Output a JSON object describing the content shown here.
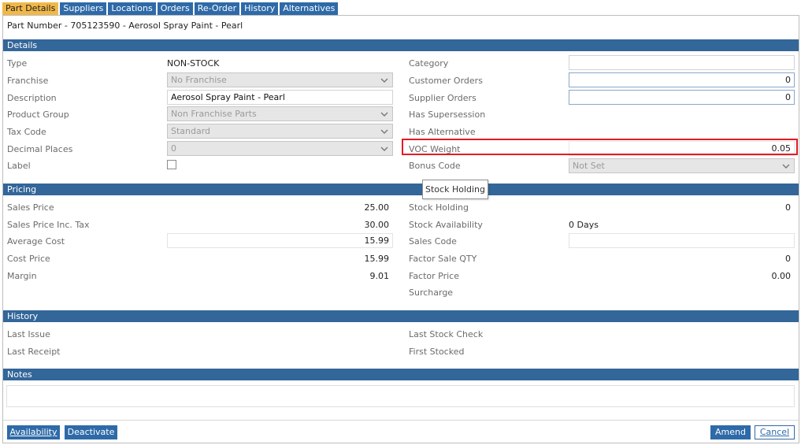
{
  "tabs": [
    {
      "label": "Part Details",
      "active": true
    },
    {
      "label": "Suppliers",
      "active": false
    },
    {
      "label": "Locations",
      "active": false
    },
    {
      "label": "Orders",
      "active": false
    },
    {
      "label": "Re-Order",
      "active": false
    },
    {
      "label": "History",
      "active": false
    },
    {
      "label": "Alternatives",
      "active": false
    }
  ],
  "header": {
    "part_number": "Part Number - 705123590 - Aerosol Spray Paint - Pearl"
  },
  "details": {
    "title": "Details",
    "type_label": "Type",
    "type_value": "NON-STOCK",
    "franchise_label": "Franchise",
    "franchise_value": "No Franchise",
    "description_label": "Description",
    "description_value": "Aerosol Spray Paint - Pearl",
    "product_group_label": "Product Group",
    "product_group_value": "Non Franchise Parts",
    "tax_code_label": "Tax Code",
    "tax_code_value": "Standard",
    "decimal_places_label": "Decimal Places",
    "decimal_places_value": "0",
    "label_label": "Label",
    "category_label": "Category",
    "category_value": "",
    "customer_orders_label": "Customer Orders",
    "customer_orders_value": "0",
    "supplier_orders_label": "Supplier Orders",
    "supplier_orders_value": "0",
    "has_supersession_label": "Has Supersession",
    "has_alternative_label": "Has Alternative",
    "voc_weight_label": "VOC Weight",
    "voc_weight_value": "0.05",
    "bonus_code_label": "Bonus Code",
    "bonus_code_value": "Not Set"
  },
  "pricing": {
    "title": "Pricing",
    "sales_price_label": "Sales Price",
    "sales_price_value": "25.00",
    "sales_price_inc_tax_label": "Sales Price Inc. Tax",
    "sales_price_inc_tax_value": "30.00",
    "average_cost_label": "Average Cost",
    "average_cost_value": "15.99",
    "cost_price_label": "Cost Price",
    "cost_price_value": "15.99",
    "margin_label": "Margin",
    "margin_value": "9.01",
    "stock_holding_label": "Stock Holding",
    "stock_holding_value": "0",
    "stock_availability_label": "Stock Availability",
    "stock_availability_value": "0 Days",
    "sales_code_label": "Sales Code",
    "sales_code_value": "",
    "factor_sale_qty_label": "Factor Sale QTY",
    "factor_sale_qty_value": "0",
    "factor_price_label": "Factor Price",
    "factor_price_value": "0.00",
    "surcharge_label": "Surcharge"
  },
  "tooltip": {
    "text": "Stock Holding"
  },
  "history": {
    "title": "History",
    "last_issue_label": "Last Issue",
    "last_receipt_label": "Last Receipt",
    "last_stock_check_label": "Last Stock Check",
    "first_stocked_label": "First Stocked"
  },
  "notes": {
    "title": "Notes",
    "value": ""
  },
  "footer": {
    "availability_label": "Availability",
    "deactivate_label": "Deactivate",
    "amend_label": "Amend",
    "cancel_label": "Cancel"
  },
  "colors": {
    "accent": "#336699",
    "active_tab": "#f0b84a",
    "highlight": "#e31b23"
  }
}
